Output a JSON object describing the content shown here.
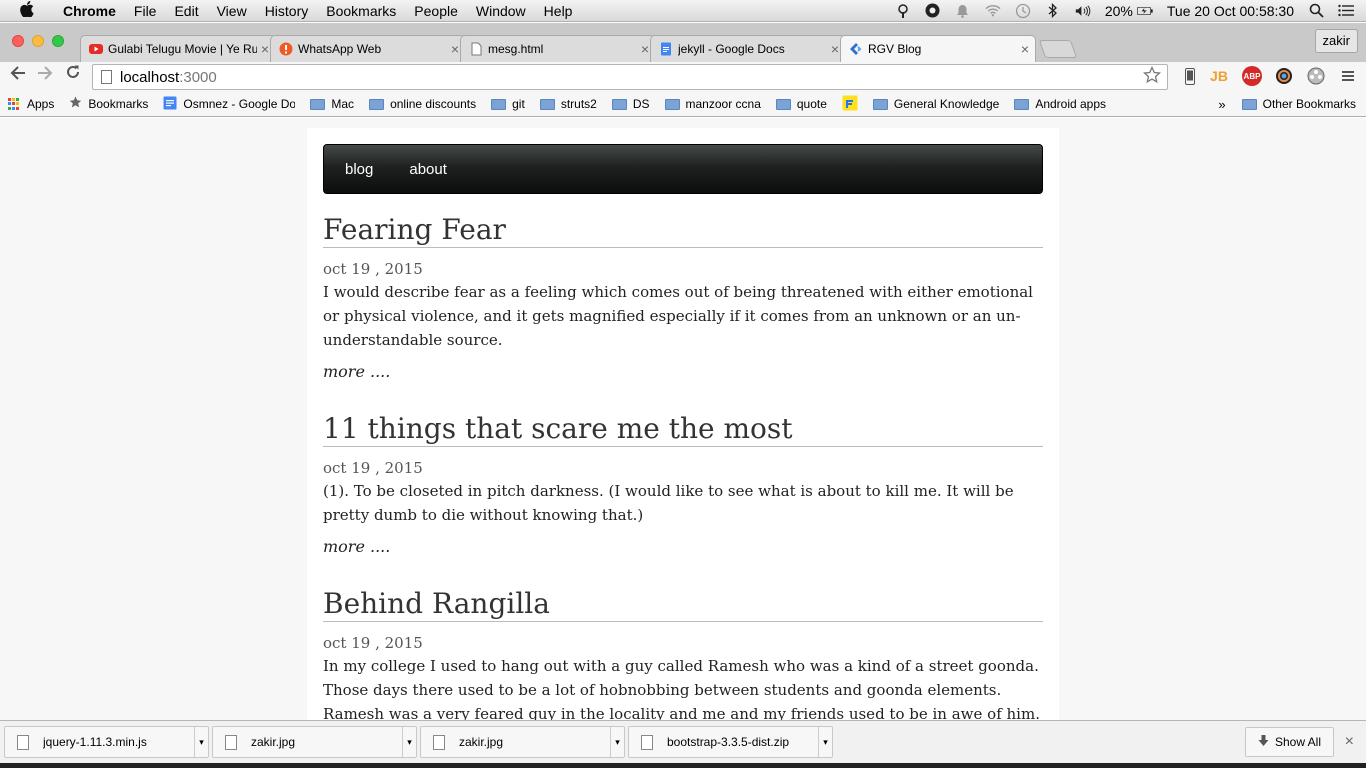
{
  "menubar": {
    "apple": "",
    "app": "Chrome",
    "items": [
      "File",
      "Edit",
      "View",
      "History",
      "Bookmarks",
      "People",
      "Window",
      "Help"
    ],
    "battery": "20%",
    "clock": "Tue 20 Oct  00:58:30"
  },
  "tabs": [
    {
      "title": "Gulabi Telugu Movie | Ye Ru",
      "favicon_color": "#e52d27"
    },
    {
      "title": "WhatsApp Web",
      "favicon_color": "#ef5b25"
    },
    {
      "title": "mesg.html",
      "favicon_color": "#ffffff"
    },
    {
      "title": "jekyll - Google Docs",
      "favicon_color": "#4285f4"
    },
    {
      "title": "RGV Blog",
      "favicon_color": "#2f6fd0"
    }
  ],
  "profile": "zakir",
  "omnibox": {
    "host": "localhost",
    "port": ":3000"
  },
  "extensions": [
    "JB",
    "ABP"
  ],
  "bookmarks": {
    "items": [
      "Apps",
      "Bookmarks",
      "Osmnez - Google Do",
      "Mac",
      "online discounts",
      "git",
      "struts2",
      "DS",
      "manzoor ccna",
      "quote",
      "",
      "General Knowledge",
      "Android apps"
    ],
    "overflow": "»",
    "other": "Other Bookmarks"
  },
  "page": {
    "nav": [
      "blog",
      "about"
    ],
    "posts": [
      {
        "title": "Fearing Fear",
        "date": "oct 19 , 2015",
        "excerpt": "I would describe fear as a feeling which comes out of being threatened with either emotional or physical violence, and it gets magnified especially if it comes from an unknown or an un-understandable source.",
        "more": "more ...."
      },
      {
        "title": "11 things that scare me the most",
        "date": "oct 19 , 2015",
        "excerpt": "(1). To be closeted in pitch darkness. (I would like to see what is about to kill me. It will be pretty dumb to die without knowing that.)",
        "more": "more ...."
      },
      {
        "title": "Behind Rangilla",
        "date": "oct 19 , 2015",
        "excerpt": "In my college I used to hang out with a guy called Ramesh who was a kind of a street goonda. Those days there used to be a lot of hobnobbing between students and goonda elements. Ramesh was a very feared guy in the locality and me and my friends used to be in awe of him. We used to spend endless",
        "more": ""
      }
    ]
  },
  "downloads": {
    "files": [
      "jquery-1.11.3.min.js",
      "zakir.jpg",
      "zakir.jpg",
      "bootstrap-3.3.5-dist.zip"
    ],
    "show_all": "Show All"
  }
}
